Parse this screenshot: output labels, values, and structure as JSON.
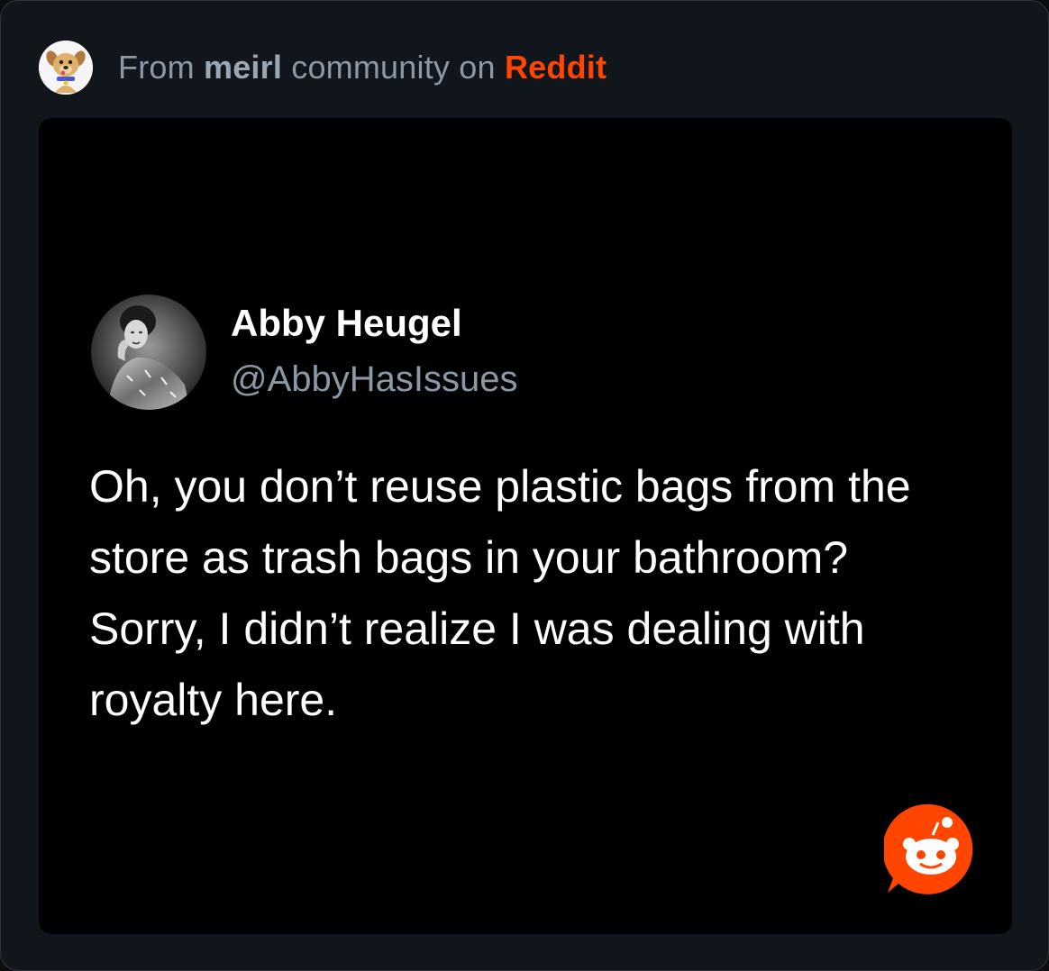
{
  "header": {
    "prefix": "From",
    "community": "meirl",
    "middle": "community on",
    "platform": "Reddit"
  },
  "post": {
    "author_name": "Abby Heugel",
    "author_handle": "@AbbyHasIssues",
    "text": "Oh, you don’t reuse plastic bags from the store as trash bags in your bathroom? Sorry, I didn’t realize I was dealing with royalty here."
  },
  "colors": {
    "accent": "#ff4500",
    "muted_text": "#8b98a5",
    "card_bg": "#11161c",
    "post_bg": "#000000"
  },
  "icons": {
    "community_avatar": "dog-mascot-icon",
    "author_avatar": "profile-photo",
    "watermark": "reddit-snoo-icon"
  }
}
